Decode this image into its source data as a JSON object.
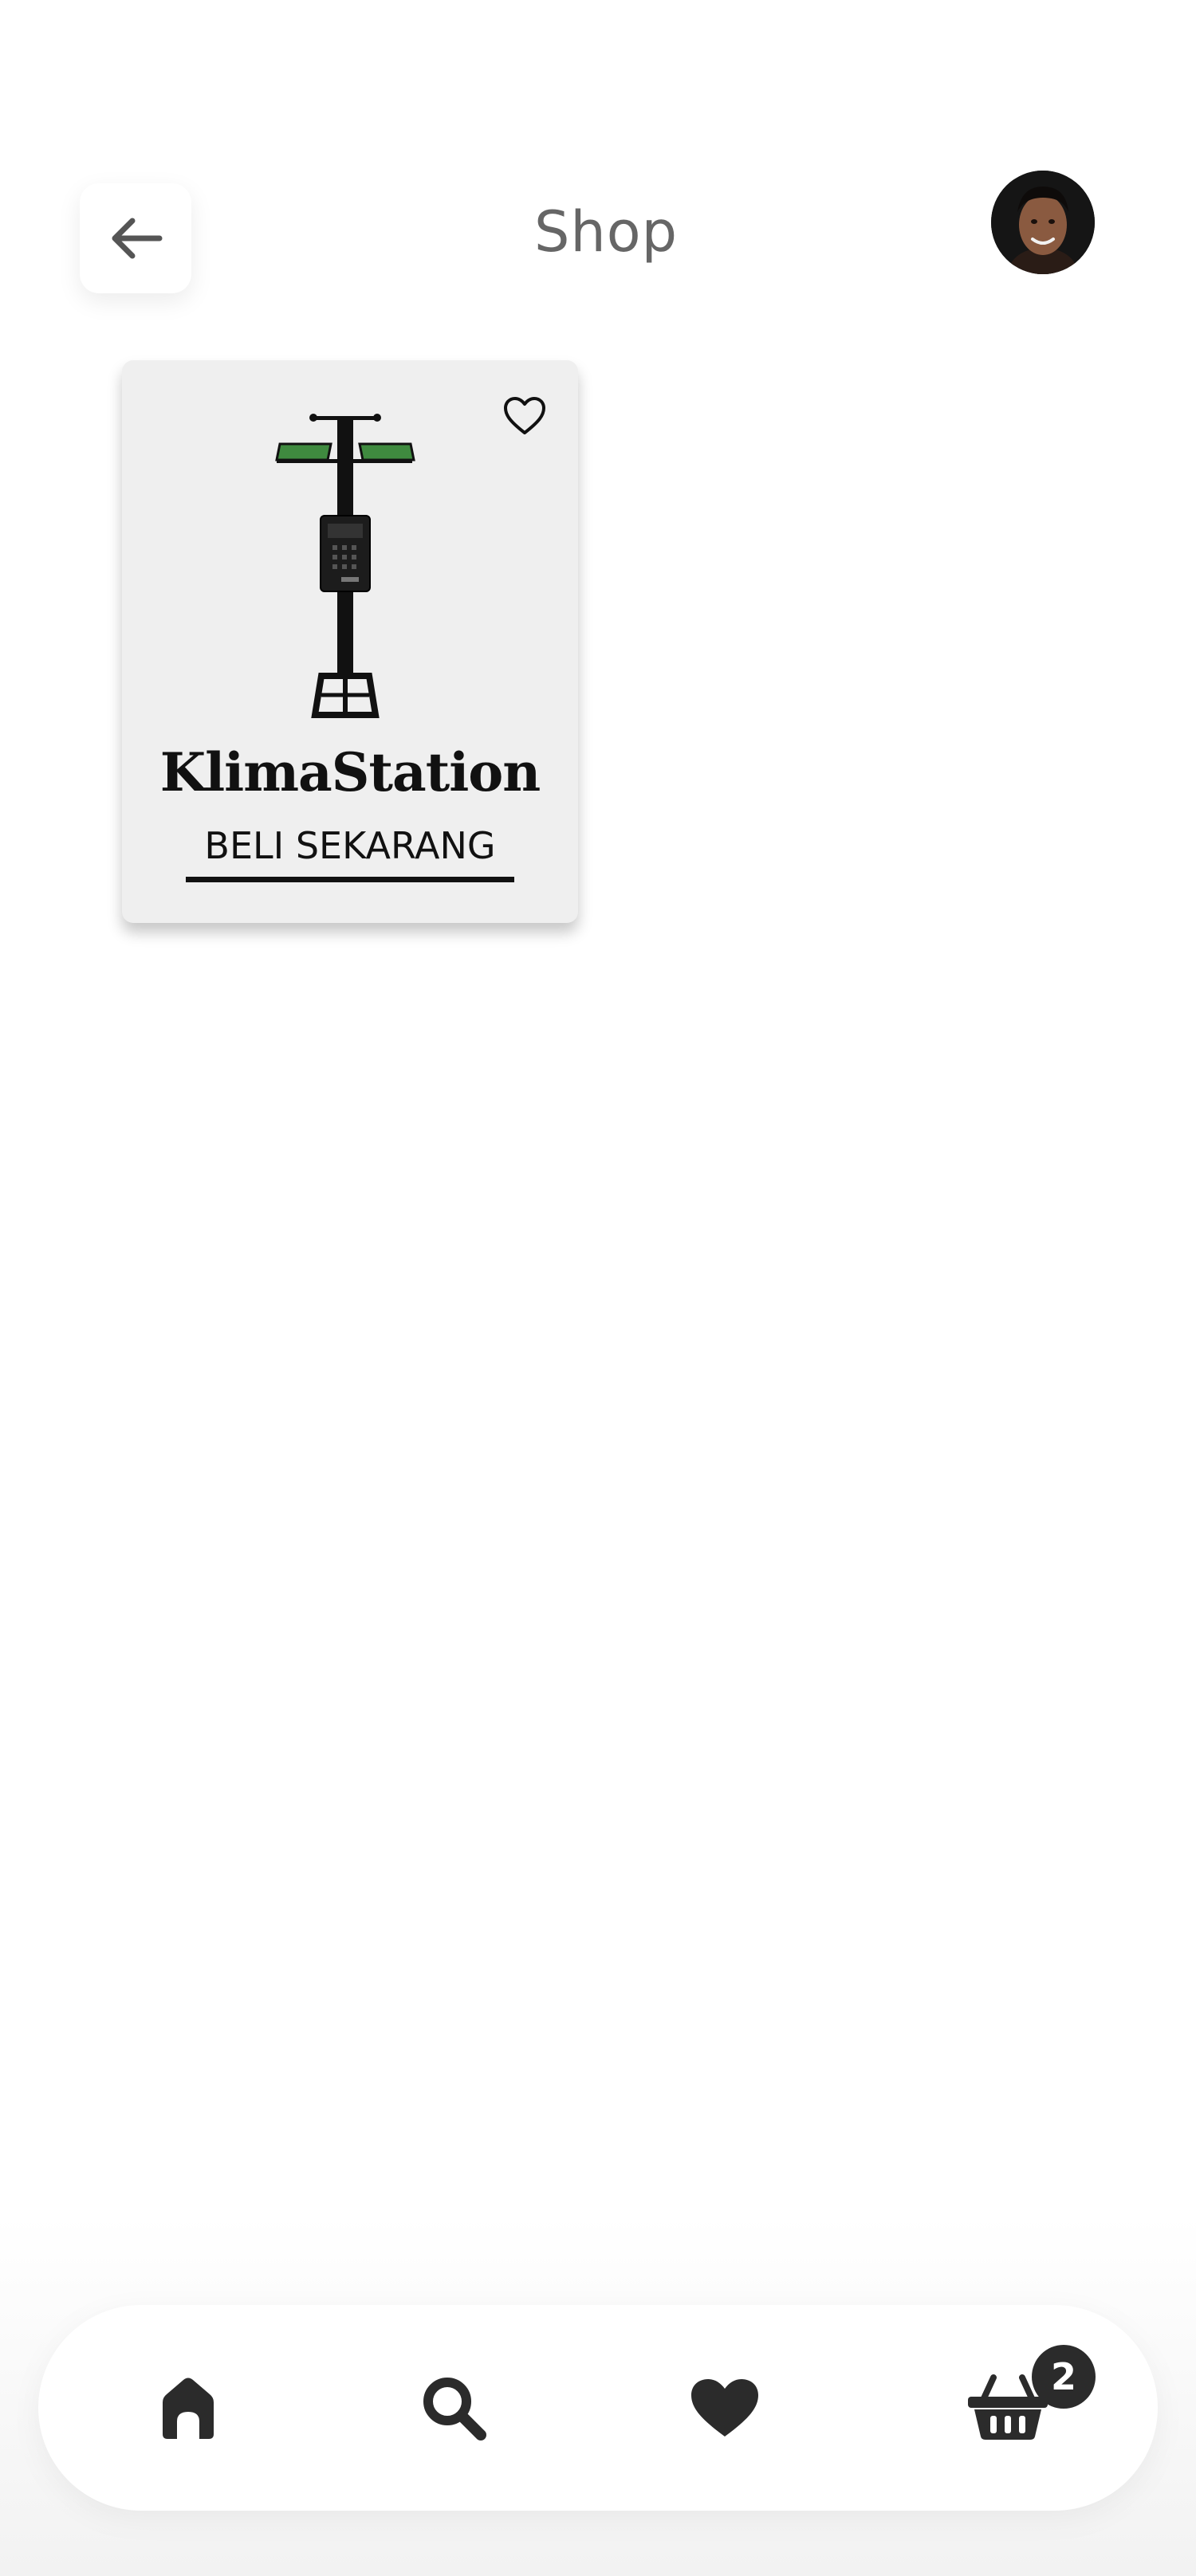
{
  "header": {
    "title": "Shop",
    "back_icon": "arrow-left-icon",
    "avatar_icon": "user-avatar"
  },
  "products": [
    {
      "name": "KlimaStation",
      "cta_label": "BELI SEKARANG",
      "favorite_icon": "heart-outline-icon",
      "image": "weather-station-image"
    }
  ],
  "bottom_nav": {
    "items": [
      {
        "icon": "home-icon"
      },
      {
        "icon": "search-icon"
      },
      {
        "icon": "heart-icon"
      },
      {
        "icon": "basket-icon"
      }
    ],
    "cart_count": "2"
  },
  "colors": {
    "title": "#666666",
    "card_bg": "#efefef",
    "icon_dark": "#2b2b2b",
    "solar_panel": "#3f8a3f"
  }
}
